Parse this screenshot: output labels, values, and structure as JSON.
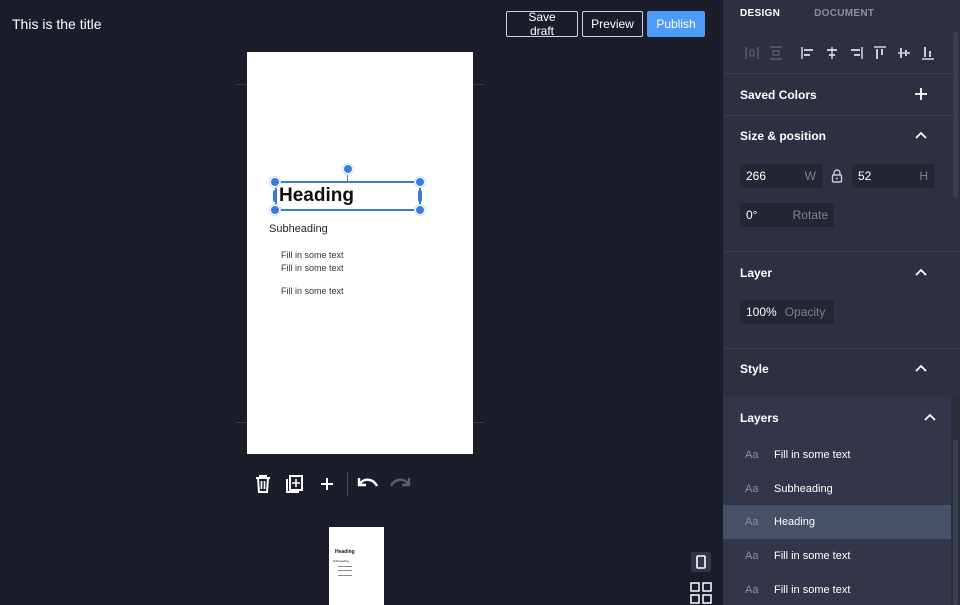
{
  "header": {
    "title": "This is the title",
    "save_draft_label": "Save draft",
    "preview_label": "Preview",
    "publish_label": "Publish"
  },
  "canvas": {
    "heading": "Heading",
    "subheading": "Subheading",
    "body_lines": [
      "Fill in some text",
      "Fill in some text",
      "Fill in some text"
    ],
    "toolbar_icons": [
      "trash-icon",
      "duplicate-page-icon",
      "add-icon",
      "undo-icon",
      "redo-icon"
    ]
  },
  "thumbnail": {
    "heading": "Heading",
    "subheading": "Subheading"
  },
  "view_icons": [
    "mobile-view-icon",
    "grid-view-icon"
  ],
  "sidebar": {
    "tabs": [
      {
        "label": "DESIGN",
        "active": true
      },
      {
        "label": "DOCUMENT",
        "active": false
      }
    ],
    "saved_colors": {
      "title": "Saved Colors"
    },
    "size_position": {
      "title": "Size & position",
      "width_value": "266",
      "width_label": "W",
      "height_value": "52",
      "height_label": "H",
      "rotate_value": "0°",
      "rotate_label": "Rotate"
    },
    "layer": {
      "title": "Layer",
      "opacity_value": "100%",
      "opacity_label": "Opacity"
    },
    "style": {
      "title": "Style"
    },
    "layers": {
      "title": "Layers",
      "type_glyph": "Aa",
      "items": [
        {
          "name": "Fill in some text",
          "selected": false
        },
        {
          "name": "Subheading",
          "selected": false
        },
        {
          "name": "Heading",
          "selected": true
        },
        {
          "name": "Fill in some text",
          "selected": false
        },
        {
          "name": "Fill in some text",
          "selected": false
        }
      ]
    }
  },
  "colors": {
    "background": "#1b1d2a",
    "sidebar": "#2d3040",
    "accent": "#4e9cf5",
    "selection": "#3a7be0"
  }
}
